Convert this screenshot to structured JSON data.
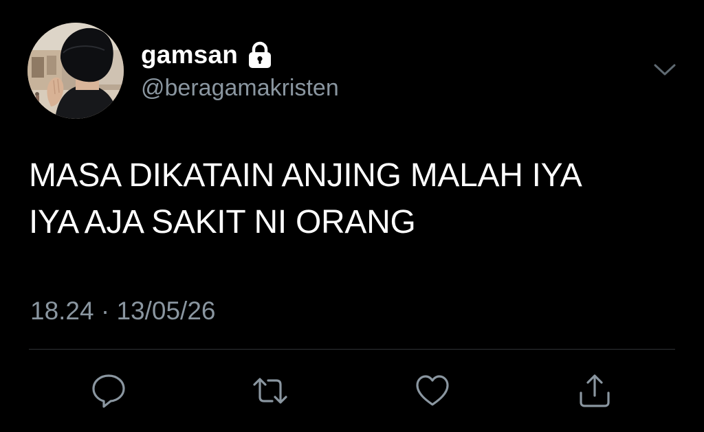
{
  "user": {
    "display_name": "gamsan",
    "username": "@beragamakristen",
    "protected_icon": "lock-icon",
    "avatar": "profile-photo"
  },
  "tweet": {
    "text": "MASA DIKATAIN ANJING MALAH IYA\nIYA AJA SAKIT NI ORANG",
    "timestamp": "18.24 · 13/05/26"
  },
  "actions": [
    {
      "icon": "reply-icon"
    },
    {
      "icon": "retweet-icon"
    },
    {
      "icon": "like-icon"
    },
    {
      "icon": "share-icon"
    }
  ],
  "menu_icon": "chevron-down-icon",
  "colors": {
    "background": "#000000",
    "primary_text": "#ffffff",
    "secondary_text": "#8a96a0",
    "divider": "#2f3336"
  }
}
